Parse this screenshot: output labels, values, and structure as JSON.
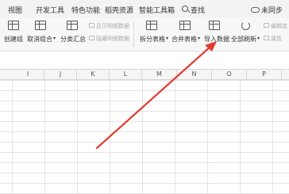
{
  "menu": {
    "items": [
      "视图",
      "开发工具",
      "特色功能",
      "稻壳资源",
      "智能工具箱"
    ],
    "search_label": "查找",
    "unsync_label": "未同步"
  },
  "ribbon": {
    "create_group": "创建组",
    "cancel_group": "取消组合",
    "subtotal": "分类汇总",
    "show_detail": "显示明细数据",
    "hide_detail": "隐藏明细数据",
    "split_table": "拆分表格",
    "merge_table": "合并表格",
    "import_data": "导入数据",
    "refresh_all": "全部刷新",
    "edit_link": "编辑连",
    "attr": "属性"
  },
  "columns": [
    "I",
    "J",
    "K",
    "L",
    "M",
    "N",
    "O",
    "P"
  ],
  "colors": {
    "arrow": "#e23a2e",
    "menubar": "#f3f3f3",
    "ribbon": "#f7f7f7"
  }
}
